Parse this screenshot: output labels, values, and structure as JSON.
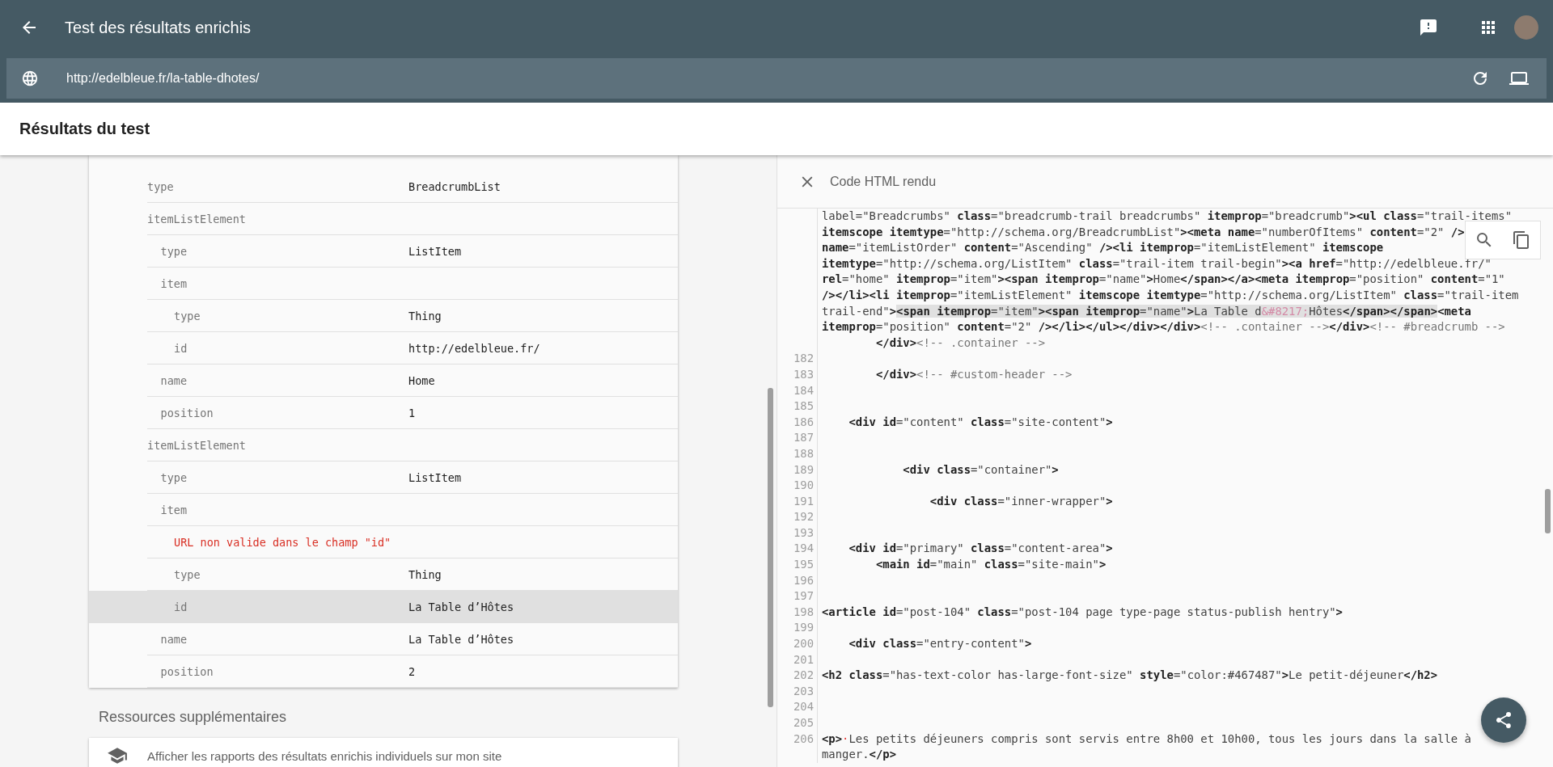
{
  "app_bar": {
    "title": "Test des résultats enrichis"
  },
  "url_bar": {
    "url": "http://edelbleue.fr/la-table-dhotes/"
  },
  "results_header": {
    "title": "Résultats du test"
  },
  "results": {
    "rows": [
      {
        "kind": "property",
        "key": "type",
        "value": "BreadcrumbList",
        "selected": false
      },
      {
        "kind": "property",
        "key": "itemListElement",
        "selected": false,
        "children": [
          {
            "kind": "property",
            "key": "type",
            "value": "ListItem",
            "selected": false
          },
          {
            "kind": "property",
            "key": "item",
            "selected": false,
            "children": [
              {
                "kind": "property",
                "key": "type",
                "value": "Thing",
                "selected": false
              },
              {
                "kind": "property",
                "key": "id",
                "value": "http://edelbleue.fr/",
                "selected": false
              }
            ]
          },
          {
            "kind": "property",
            "key": "name",
            "value": "Home",
            "selected": false
          },
          {
            "kind": "property",
            "key": "position",
            "value": "1",
            "selected": false
          }
        ]
      },
      {
        "kind": "property",
        "key": "itemListElement",
        "selected": false,
        "children": [
          {
            "kind": "property",
            "key": "type",
            "value": "ListItem",
            "selected": false
          },
          {
            "kind": "property",
            "key": "item",
            "selected": false,
            "children": [
              {
                "kind": "error",
                "message": "URL non valide dans le champ \"id\"",
                "selected": false
              },
              {
                "kind": "property",
                "key": "type",
                "value": "Thing",
                "selected": false
              },
              {
                "kind": "property",
                "key": "id",
                "value": "La Table d’Hôtes",
                "selected": true
              }
            ]
          },
          {
            "kind": "property",
            "key": "name",
            "value": "La Table d’Hôtes",
            "selected": false
          },
          {
            "kind": "property",
            "key": "position",
            "value": "2",
            "selected": false
          }
        ]
      }
    ]
  },
  "resources": {
    "title": "Ressources supplémentaires",
    "items": [
      {
        "label": "Afficher les rapports des résultats enrichis individuels sur mon site"
      }
    ]
  },
  "code_panel": {
    "title": "Code HTML rendu",
    "lines": [
      {
        "segments": [
          {
            "kind": "code",
            "text": "label=\"Breadcrumbs\" **class**=\"breadcrumb-trail breadcrumbs\" **itemprop**=\"breadcrumb\"**><ul class**=\"trail-items\""
          }
        ]
      },
      {
        "segments": [
          {
            "kind": "code",
            "text": "**itemscope itemtype**=\"http://schema.org/BreadcrumbList\"**><meta name**=\"numberOfItems\" **content**=\"2\" **/>**"
          }
        ]
      },
      {
        "segments": [
          {
            "kind": "code",
            "text": "**name**=\"itemListOrder\" **content**=\"Ascending\" **/><li itemprop**=\"itemListElement\" **itemscope**"
          }
        ]
      },
      {
        "segments": [
          {
            "kind": "code",
            "text": "**itemtype**=\"http://schema.org/ListItem\" **class**=\"trail-item trail-begin\"**><a href**=\"http://edelbleue.fr/\""
          }
        ]
      },
      {
        "segments": [
          {
            "kind": "code",
            "text": "**rel**=\"home\" **itemprop**=\"item\"**><span itemprop**=\"name\"**>**Home**</span></a><meta itemprop**=\"position\" **content**=\"1\""
          }
        ]
      },
      {
        "segments": [
          {
            "kind": "code",
            "text": "**/></li><li itemprop**=\"itemListElement\" **itemscope itemtype**=\"http://schema.org/ListItem\" **class**=\"trail-item"
          }
        ]
      },
      {
        "segments": [
          {
            "kind": "code",
            "text": "trail-end\"**>**"
          },
          {
            "kind": "highlight",
            "segments": [
              {
                "kind": "code",
                "text": "**<span itemprop**=\"item\"**><span itemprop**=\"name\"**>**La Table d"
              },
              {
                "kind": "entity",
                "text": "&#8217;"
              },
              {
                "kind": "code",
                "text": "Hôtes**</span></span>**"
              }
            ]
          },
          {
            "kind": "code",
            "text": "**<meta**"
          }
        ]
      },
      {
        "segments": [
          {
            "kind": "code",
            "text": "**itemprop**=\"position\" **content**=\"2\" **/></li></ul></div></div>**"
          },
          {
            "kind": "comment",
            "text": "<!-- .container -->"
          },
          {
            "kind": "code",
            "text": "**</div>**"
          },
          {
            "kind": "comment",
            "text": "<!-- #breadcrumb -->"
          }
        ]
      },
      {
        "segments": [
          {
            "kind": "code",
            "text": "        **</div>**"
          },
          {
            "kind": "comment",
            "text": "<!-- .container -->"
          }
        ]
      },
      {
        "number": "182"
      },
      {
        "number": "183",
        "segments": [
          {
            "kind": "code",
            "text": "        **</div>**"
          },
          {
            "kind": "comment",
            "text": "<!-- #custom-header -->"
          }
        ]
      },
      {
        "number": "184"
      },
      {
        "number": "185"
      },
      {
        "number": "186",
        "segments": [
          {
            "kind": "code",
            "text": "    **<div id**=\"content\" **class**=\"site-content\"**>**"
          }
        ]
      },
      {
        "number": "187"
      },
      {
        "number": "188"
      },
      {
        "number": "189",
        "segments": [
          {
            "kind": "code",
            "text": "            **<div class**=\"container\"**>**"
          }
        ]
      },
      {
        "number": "190"
      },
      {
        "number": "191",
        "segments": [
          {
            "kind": "code",
            "text": "                **<div class**=\"inner-wrapper\"**>**"
          }
        ]
      },
      {
        "number": "192"
      },
      {
        "number": "193"
      },
      {
        "number": "194",
        "segments": [
          {
            "kind": "code",
            "text": "    **<div id**=\"primary\" **class**=\"content-area\"**>**"
          }
        ]
      },
      {
        "number": "195",
        "segments": [
          {
            "kind": "code",
            "text": "        **<main id**=\"main\" **class**=\"site-main\"**>**"
          }
        ]
      },
      {
        "number": "196"
      },
      {
        "number": "197"
      },
      {
        "number": "198",
        "segments": [
          {
            "kind": "code",
            "text": "**<article id**=\"post-104\" **class**=\"post-104 page type-page status-publish hentry\"**>**"
          }
        ]
      },
      {
        "number": "199"
      },
      {
        "number": "200",
        "segments": [
          {
            "kind": "code",
            "text": "    **<div class**=\"entry-content\"**>**"
          }
        ]
      },
      {
        "number": "201"
      },
      {
        "number": "202",
        "segments": [
          {
            "kind": "code",
            "text": "**<h2 class**=\"has-text-color has-large-font-size\" **style**=\"color:#467487\"**>**Le petit-déjeuner**</h2>**"
          }
        ]
      },
      {
        "number": "203"
      },
      {
        "number": "204"
      },
      {
        "number": "205"
      },
      {
        "number": "206",
        "segments": [
          {
            "kind": "code",
            "text": "**<p>**"
          },
          {
            "kind": "marker",
            "text": "·"
          },
          {
            "kind": "code",
            "text": "Les petits déjeuners compris sont servis entre 8h00 et 10h00, tous les jours dans la salle à"
          }
        ]
      },
      {
        "segments": [
          {
            "kind": "code",
            "text": "manger.**</p>**"
          }
        ]
      }
    ]
  }
}
